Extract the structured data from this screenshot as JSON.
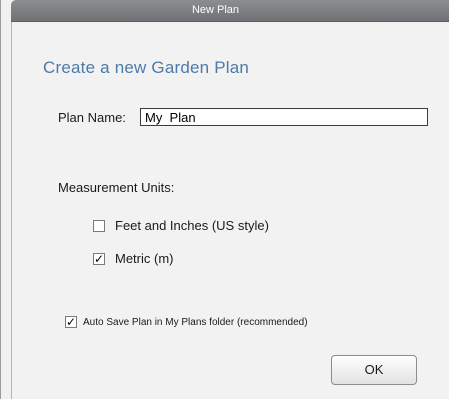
{
  "window": {
    "title": "New Plan"
  },
  "dialog": {
    "heading": "Create a new Garden Plan",
    "plan_name": {
      "label": "Plan Name:",
      "value": "My  Plan"
    },
    "measurement_units": {
      "label": "Measurement Units:",
      "options": [
        {
          "label": "Feet and Inches (US style)",
          "checked": false
        },
        {
          "label": "Metric (m)",
          "checked": true
        }
      ]
    },
    "auto_save": {
      "label": "Auto Save Plan in My Plans folder (recommended)",
      "checked": true
    },
    "ok_label": "OK"
  },
  "colors": {
    "heading": "#4d7aa8",
    "titlebar": "#7d7f82",
    "background": "#f2f2f2"
  },
  "glyphs": {
    "check": "✓"
  }
}
